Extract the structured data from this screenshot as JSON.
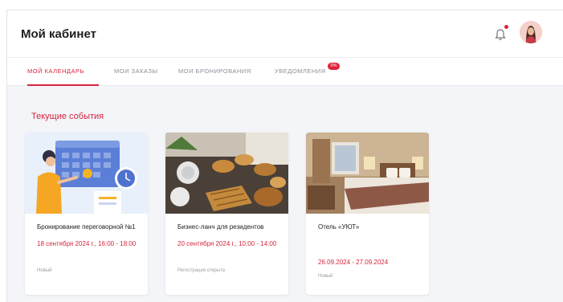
{
  "header": {
    "title": "Мой кабинет"
  },
  "tabs": [
    {
      "label": "Мой календарь"
    },
    {
      "label": "Мои заказы"
    },
    {
      "label": "Мои бронирования"
    },
    {
      "label": "Уведомления",
      "badge": "0%"
    }
  ],
  "section": {
    "title": "Текущие события"
  },
  "cards": [
    {
      "title": "Бронирование переговорной №1",
      "date": "18 сентября 2024 г., 16:00 - 18:00",
      "status": "Новый"
    },
    {
      "title": "Бизнес-ланч для резидентов",
      "date": "20 сентября 2024 г., 10:00 - 14:00",
      "status": "Регистрация открыта"
    },
    {
      "title": "Отель «УЮТ»",
      "date": "26.09.2024 - 27.09.2024",
      "status": "Новый"
    }
  ],
  "colors": {
    "accent": "#d6243c",
    "background": "#f3f5f8"
  },
  "icons": {
    "bell": "bell-icon",
    "avatar": "user-avatar"
  }
}
